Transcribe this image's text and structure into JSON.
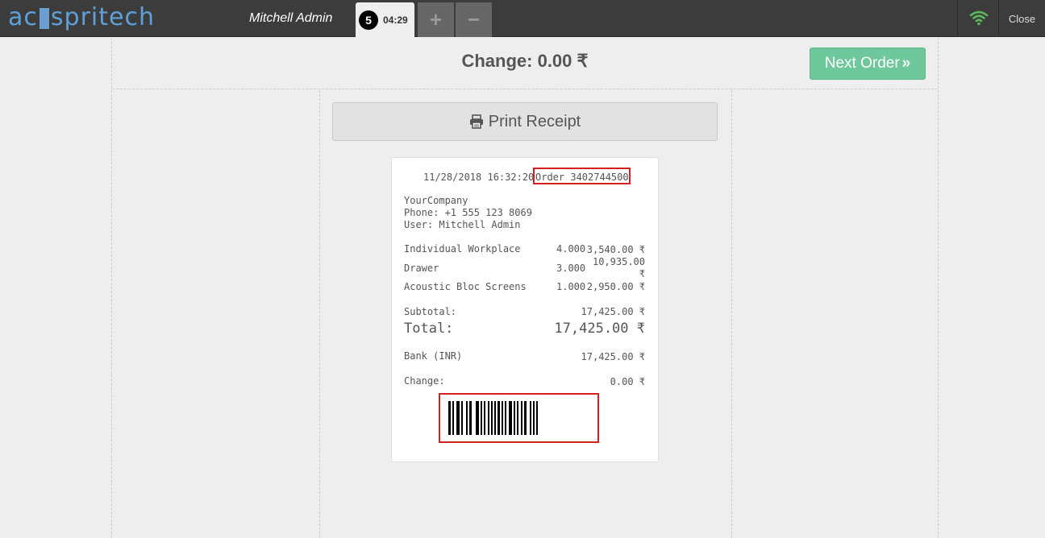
{
  "header": {
    "logo_text_left": "ac",
    "logo_text_right": "spritech",
    "user_name": "Mitchell Admin",
    "order_tab": {
      "number": "5",
      "time": "04:29"
    },
    "add_order_symbol": "+",
    "remove_order_symbol": "−",
    "wifi_icon": "wifi-icon",
    "wifi_color": "#5cb85c",
    "close_label": "Close"
  },
  "screen": {
    "change_title": "Change: 0.00 ₹",
    "next_order_label": "Next Order",
    "next_order_icon": "»",
    "print_receipt_label": "Print Receipt",
    "print_icon": "printer-icon"
  },
  "receipt": {
    "datetime": "11/28/2018 16:32:20",
    "order_ref": "Order 3402744500",
    "company": "YourCompany",
    "phone": "Phone: +1 555 123 8069",
    "user": "User: Mitchell Admin",
    "lines": [
      {
        "product": "Individual Workplace",
        "qty": "4.000",
        "price": "3,540.00 ₹"
      },
      {
        "product": "Drawer",
        "qty": "3.000",
        "price_line1": "10,935.00",
        "price_line2": "₹"
      },
      {
        "product": "Acoustic Bloc Screens",
        "qty": "1.000",
        "price": "2,950.00 ₹"
      }
    ],
    "subtotal_label": "Subtotal:",
    "subtotal_value": "17,425.00 ₹",
    "total_label": "Total:",
    "total_value": "17,425.00 ₹",
    "payment_label": "Bank (INR)",
    "payment_value": "17,425.00 ₹",
    "change_label": "Change:",
    "change_value": "0.00 ₹"
  }
}
